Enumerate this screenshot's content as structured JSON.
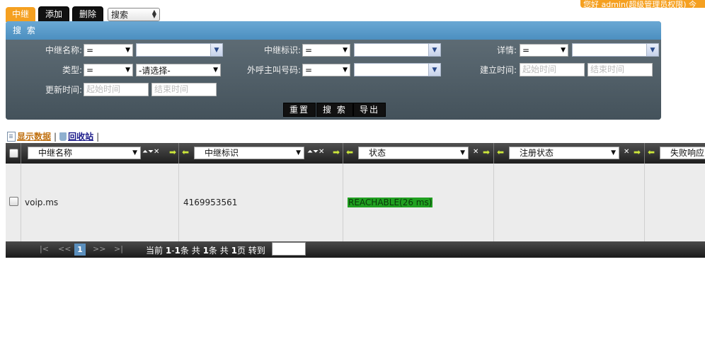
{
  "tabs": {
    "items": [
      {
        "label": "中继",
        "state": "active"
      },
      {
        "label": "添加",
        "state": "normal"
      },
      {
        "label": "删除",
        "state": "normal"
      }
    ],
    "select_value": "搜索"
  },
  "user_badge": "您好 admin(超级管理员权限) 今",
  "search": {
    "title": "搜 索",
    "fields": {
      "trunk_name_label": "中继名称:",
      "trunk_id_label": "中继标识:",
      "detail_label": "详情:",
      "type_label": "类型:",
      "caller_label": "外呼主叫号码:",
      "created_label": "建立时间:",
      "updated_label": "更新时间:",
      "op_equals": "=",
      "type_placeholder": "-请选择-",
      "start_placeholder": "起始时间",
      "end_placeholder": "结束时间"
    },
    "buttons": {
      "reset": "重置",
      "search": "搜 索",
      "export": "导出"
    }
  },
  "links": {
    "show_data": "显示数据",
    "recycle": "回收站",
    "sep": "|"
  },
  "grid": {
    "columns": [
      "中继名称",
      "中继标识",
      "状态",
      "注册状态",
      "失败响应"
    ],
    "rows": [
      {
        "name": "voip.ms",
        "id": "4169953561",
        "status": "REACHABLE(26 ms)",
        "reg_status": "",
        "fail": ""
      }
    ],
    "status_color": "#20a020"
  },
  "pager": {
    "first": "|<",
    "prev": "<<",
    "current": "1",
    "next": ">>",
    "last": ">|",
    "info_prefix": "当前",
    "range_start": "1",
    "range_dash": "-",
    "range_end": "1",
    "info_mid1": "条 共",
    "total_rows": "1",
    "info_mid2": "条 共",
    "total_pages": "1",
    "info_suffix": "页 转到"
  },
  "colors": {
    "accent": "#f5a020",
    "header_blue": "#4c8fc0",
    "panel": "#505e67"
  }
}
